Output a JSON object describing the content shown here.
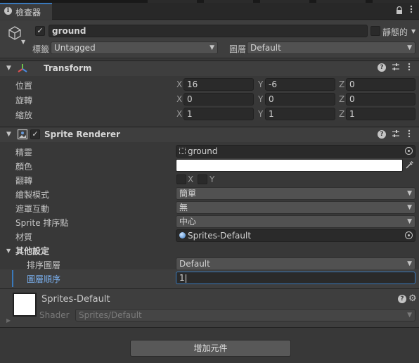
{
  "window": {
    "tab_label": "檢查器",
    "tab_icon": "info-icon"
  },
  "object": {
    "name": "ground",
    "active": true,
    "static_label": "靜態的",
    "tag_label": "標籤",
    "tag_value": "Untagged",
    "layer_label": "圖層",
    "layer_value": "Default"
  },
  "transform": {
    "title": "Transform",
    "rows": [
      {
        "label": "位置",
        "x": "16",
        "y": "-6",
        "z": "0"
      },
      {
        "label": "旋轉",
        "x": "0",
        "y": "0",
        "z": "0"
      },
      {
        "label": "縮放",
        "x": "1",
        "y": "1",
        "z": "1"
      }
    ],
    "axes": {
      "x": "X",
      "y": "Y",
      "z": "Z"
    }
  },
  "sprite_renderer": {
    "title": "Sprite Renderer",
    "enabled": true,
    "sprite_label": "精靈",
    "sprite_value": "ground",
    "color_label": "顏色",
    "color_value": "#ffffff",
    "flip_label": "翻轉",
    "flip_x": "X",
    "flip_y": "Y",
    "draw_mode_label": "繪製模式",
    "draw_mode_value": "簡單",
    "mask_label": "遮罩互動",
    "mask_value": "無",
    "sort_point_label": "Sprite 排序點",
    "sort_point_value": "中心",
    "material_label": "材質",
    "material_value": "Sprites-Default",
    "additional_label": "其他設定",
    "sorting_layer_label": "排序圖層",
    "sorting_layer_value": "Default",
    "order_label": "圖層順序",
    "order_value": "1"
  },
  "material": {
    "name": "Sprites-Default",
    "shader_label": "Shader",
    "shader_value": "Sprites/Default"
  },
  "add_component_label": "增加元件"
}
